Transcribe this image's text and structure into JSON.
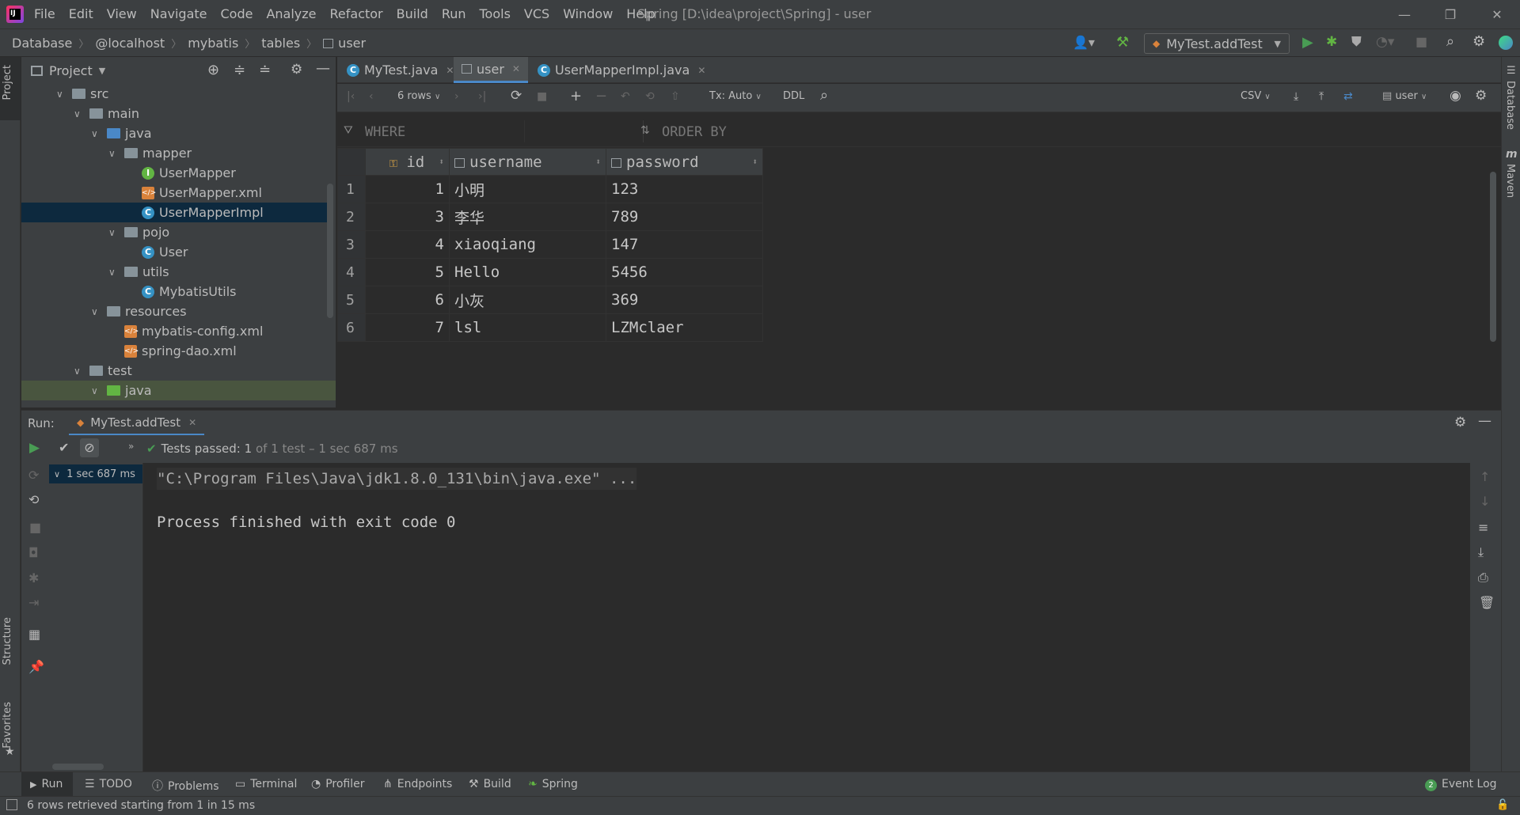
{
  "title_bar": {
    "menu": [
      "File",
      "Edit",
      "View",
      "Navigate",
      "Code",
      "Analyze",
      "Refactor",
      "Build",
      "Run",
      "Tools",
      "VCS",
      "Window",
      "Help"
    ],
    "window_title": "Spring [D:\\idea\\project\\Spring] - user"
  },
  "nav": {
    "breadcrumbs": [
      "Database",
      "@localhost",
      "mybatis",
      "tables",
      "user"
    ],
    "run_config": "MyTest.addTest"
  },
  "project": {
    "header": "Project",
    "tree": [
      {
        "label": "src",
        "type": "folder",
        "depth": 0
      },
      {
        "label": "main",
        "type": "folder",
        "depth": 1
      },
      {
        "label": "java",
        "type": "folder-blue",
        "depth": 2
      },
      {
        "label": "mapper",
        "type": "folder",
        "depth": 3
      },
      {
        "label": "UserMapper",
        "type": "interface",
        "depth": 4
      },
      {
        "label": "UserMapper.xml",
        "type": "xml",
        "depth": 4
      },
      {
        "label": "UserMapperImpl",
        "type": "class",
        "depth": 4,
        "selected": true
      },
      {
        "label": "pojo",
        "type": "folder",
        "depth": 3
      },
      {
        "label": "User",
        "type": "class",
        "depth": 4
      },
      {
        "label": "utils",
        "type": "folder",
        "depth": 3
      },
      {
        "label": "MybatisUtils",
        "type": "class",
        "depth": 4
      },
      {
        "label": "resources",
        "type": "folder",
        "depth": 2
      },
      {
        "label": "mybatis-config.xml",
        "type": "xml",
        "depth": 3
      },
      {
        "label": "spring-dao.xml",
        "type": "xml",
        "depth": 3
      },
      {
        "label": "test",
        "type": "folder",
        "depth": 1
      },
      {
        "label": "java",
        "type": "folder-green",
        "depth": 2
      }
    ]
  },
  "editor_tabs": [
    {
      "label": "MyTest.java",
      "active": false
    },
    {
      "label": "user",
      "active": true
    },
    {
      "label": "UserMapperImpl.java",
      "active": false
    }
  ],
  "grid_toolbar": {
    "rows": "6 rows",
    "tx": "Tx: Auto",
    "ddl": "DDL",
    "format": "CSV",
    "schema": "user"
  },
  "filter": {
    "where": "WHERE",
    "order_by": "ORDER BY"
  },
  "table": {
    "columns": [
      "id",
      "username",
      "password"
    ],
    "rows": [
      {
        "n": "1",
        "id": "1",
        "username": "小明",
        "password": "123"
      },
      {
        "n": "2",
        "id": "3",
        "username": "李华",
        "password": "789"
      },
      {
        "n": "3",
        "id": "4",
        "username": "xiaoqiang",
        "password": "147"
      },
      {
        "n": "4",
        "id": "5",
        "username": "Hello",
        "password": "5456"
      },
      {
        "n": "5",
        "id": "6",
        "username": "小灰",
        "password": "369"
      },
      {
        "n": "6",
        "id": "7",
        "username": "lsl",
        "password": "LZMclaer"
      }
    ]
  },
  "run": {
    "label": "Run:",
    "tab": "MyTest.addTest",
    "tests_passed": "Tests passed:",
    "tests_count": "1",
    "tests_detail": "of 1 test – 1 sec 687 ms",
    "tree_item": "1 sec 687 ms",
    "console_line1": "\"C:\\Program Files\\Java\\jdk1.8.0_131\\bin\\java.exe\" ...",
    "console_line2": "Process finished with exit code 0"
  },
  "bottom_tabs": [
    "Run",
    "TODO",
    "Problems",
    "Terminal",
    "Profiler",
    "Endpoints",
    "Build",
    "Spring"
  ],
  "event_log": {
    "count": "2",
    "label": "Event Log"
  },
  "side_tabs": {
    "project": "Project",
    "structure": "Structure",
    "favorites": "Favorites",
    "database": "Database",
    "maven": "Maven"
  },
  "status": "6 rows retrieved starting from 1 in 15 ms",
  "colors": {
    "accent": "#4a88c7",
    "selected": "#0d293e",
    "green": "#499c54",
    "bg": "#2b2b2b",
    "panel": "#3c3f41"
  }
}
